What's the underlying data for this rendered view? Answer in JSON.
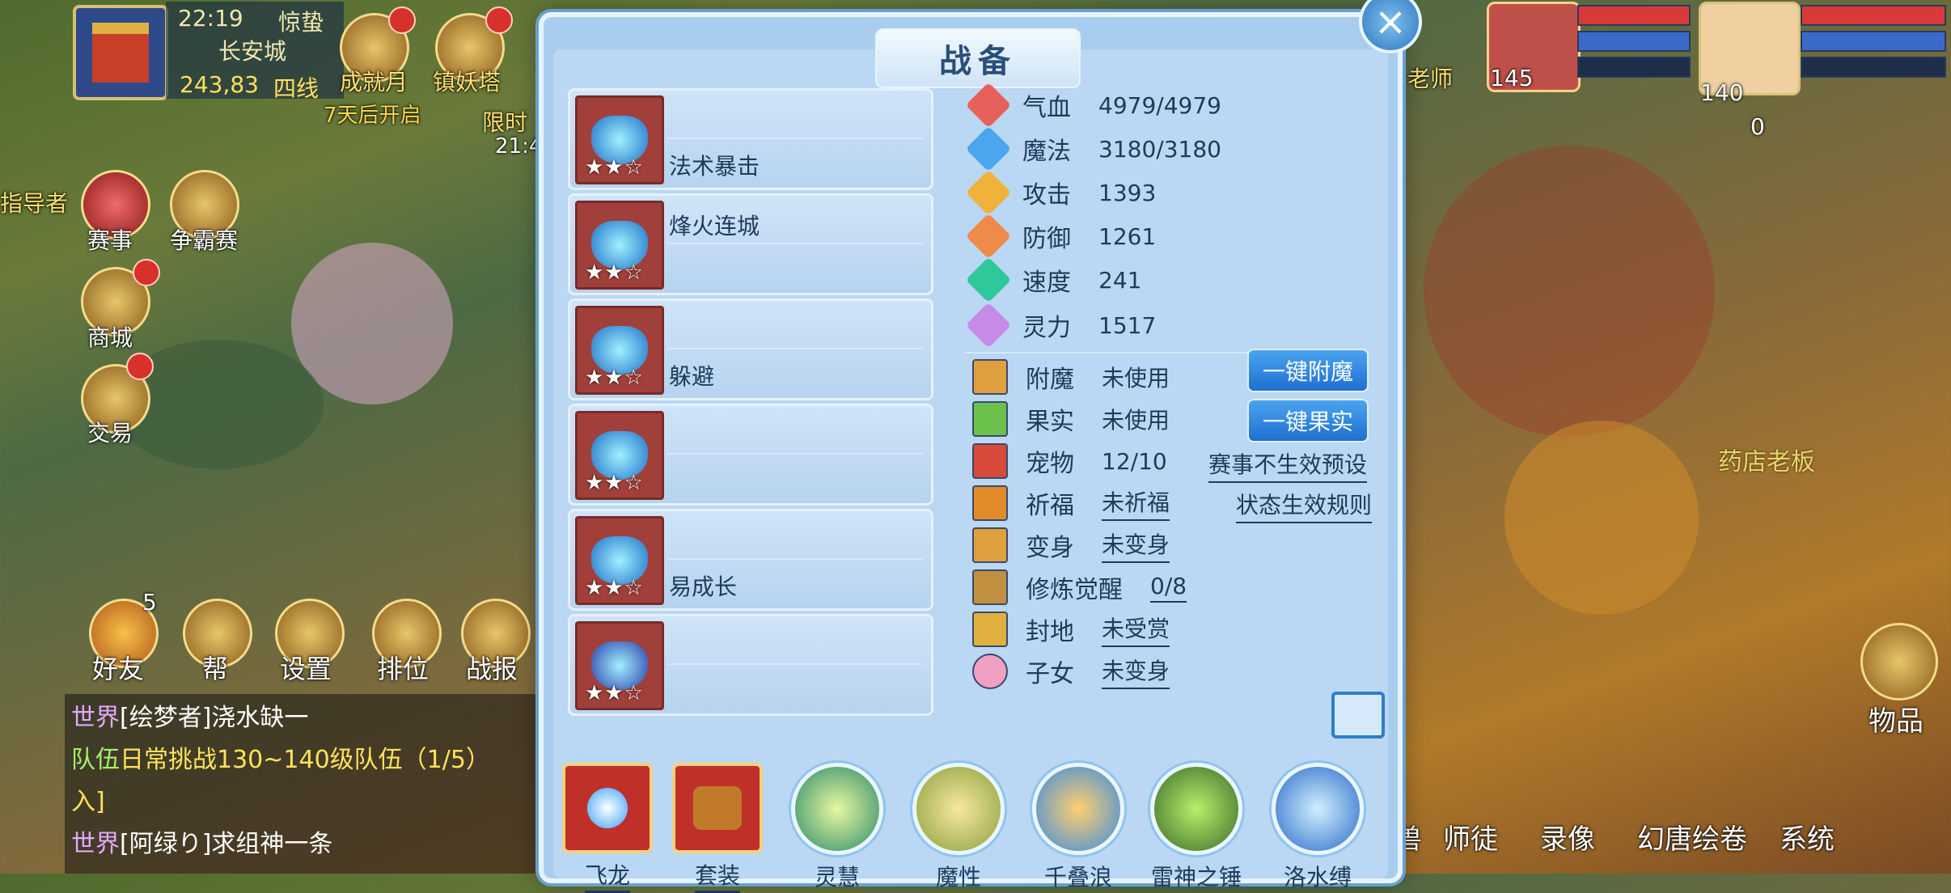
{
  "hud": {
    "time": "22:19",
    "term": "惊蛰",
    "location": "长安城",
    "coords": "243,83",
    "line": "四线",
    "top_icons": [
      "成就月",
      "镇妖塔"
    ],
    "event_text": "7天后开启",
    "limit_text": "限时",
    "limit_time": "21:4",
    "guide_text": "指导者",
    "left_icons": [
      "赛事",
      "争霸赛",
      "商城",
      "交易"
    ],
    "bottom_icons": [
      "好友",
      "帮",
      "设置",
      "排位",
      "战报"
    ],
    "friend_badge": "5"
  },
  "chat": {
    "lines": [
      {
        "channel": "世界",
        "text": "[绘梦者]浇水缺一"
      },
      {
        "channel": "队伍",
        "text": "日常挑战130~140级队伍（1/5）"
      },
      {
        "channel": "",
        "text": "入]"
      },
      {
        "channel": "世界",
        "text": "[阿绿り]求组神一条"
      }
    ]
  },
  "modal": {
    "title": "战备",
    "close_icon": "×",
    "cards": [
      {
        "name": "法术暴击",
        "stars": "★★☆"
      },
      {
        "name": "烽火连城",
        "stars": "★★☆"
      },
      {
        "name": "躲避",
        "stars": "★★☆"
      },
      {
        "name": "",
        "stars": "★★☆"
      },
      {
        "name": "易成长",
        "stars": "★★☆"
      },
      {
        "name": "",
        "stars": "★★☆"
      }
    ],
    "stats": [
      {
        "label": "气血",
        "value": "4979/4979",
        "color": "#e8605a"
      },
      {
        "label": "魔法",
        "value": "3180/3180",
        "color": "#4aa6ee"
      },
      {
        "label": "攻击",
        "value": "1393",
        "color": "#f0b23a"
      },
      {
        "label": "防御",
        "value": "1261",
        "color": "#f08a4a"
      },
      {
        "label": "速度",
        "value": "241",
        "color": "#2ec89a"
      },
      {
        "label": "灵力",
        "value": "1517",
        "color": "#c88ae8"
      }
    ],
    "status": [
      {
        "label": "附魔",
        "value": "未使用",
        "underline": false
      },
      {
        "label": "果实",
        "value": "未使用",
        "underline": false
      },
      {
        "label": "宠物",
        "value": "12/10",
        "underline": false
      },
      {
        "label": "祈福",
        "value": "未祈福",
        "underline": true
      },
      {
        "label": "变身",
        "value": "未变身",
        "underline": true
      },
      {
        "label": "修炼觉醒",
        "value": "0/8",
        "underline": true
      },
      {
        "label": "封地",
        "value": "未受赏",
        "underline": true
      },
      {
        "label": "子女",
        "value": "未变身",
        "underline": true
      }
    ],
    "btn_enchant": "一键附魔",
    "btn_fruit": "一键果实",
    "link_preset": "赛事不生效预设",
    "link_rules": "状态生效规则",
    "bottom_items": [
      "飞龙",
      "套装",
      "灵慧",
      "魔性",
      "千叠浪",
      "雷神之锤",
      "洛水缚"
    ]
  },
  "right_hud": {
    "pet_level": "145",
    "player_level": "140",
    "counter": "0",
    "npc_name": "药店老板",
    "gift_label": "老师",
    "items_label": "物品",
    "bottom_icons": [
      "兽",
      "师徒",
      "录像",
      "幻唐绘卷",
      "系统"
    ]
  }
}
